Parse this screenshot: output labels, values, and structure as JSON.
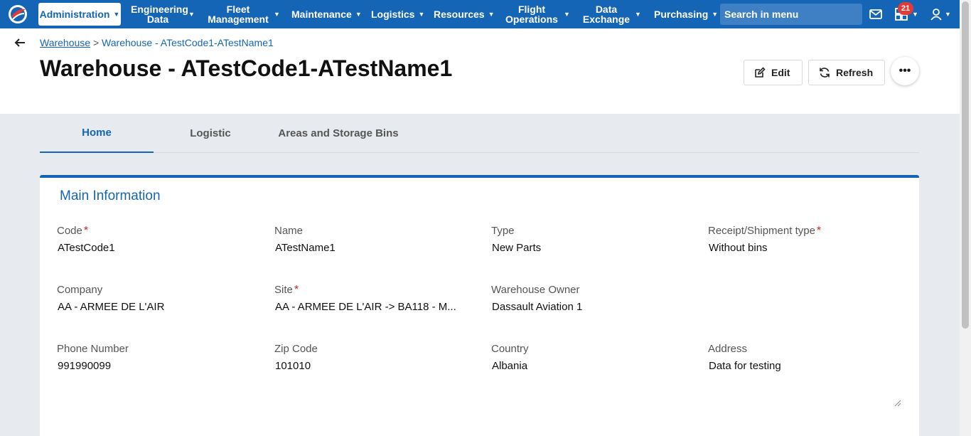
{
  "nav": {
    "items": [
      {
        "label": "Administration"
      },
      {
        "label": "Engineering Data"
      },
      {
        "label": "Fleet Management"
      },
      {
        "label": "Maintenance"
      },
      {
        "label": "Logistics"
      },
      {
        "label": "Resources"
      },
      {
        "label": "Flight Operations"
      },
      {
        "label": "Data Exchange"
      },
      {
        "label": "Purchasing"
      }
    ],
    "search_placeholder": "Search in menu",
    "badge_count": "21",
    "icons": [
      "mail-icon",
      "dashboard-icon",
      "user-icon"
    ],
    "accent_color": "#1565b7"
  },
  "breadcrumb": {
    "link": "Warehouse",
    "separator": ">",
    "current": "Warehouse - ATestCode1-ATestName1"
  },
  "page": {
    "title": "Warehouse - ATestCode1-ATestName1",
    "edit_label": "Edit",
    "refresh_label": "Refresh",
    "more_label": "•••"
  },
  "tabs": [
    {
      "label": "Home",
      "active": true
    },
    {
      "label": "Logistic",
      "active": false
    },
    {
      "label": "Areas and Storage Bins",
      "active": false
    }
  ],
  "section": {
    "title": "Main Information",
    "fields": [
      {
        "label": "Code",
        "required": true,
        "value": "ATestCode1"
      },
      {
        "label": "Name",
        "required": false,
        "value": "ATestName1"
      },
      {
        "label": "Type",
        "required": false,
        "value": "New Parts"
      },
      {
        "label": "Receipt/Shipment type",
        "required": true,
        "value": "Without bins"
      },
      {
        "label": "Company",
        "required": false,
        "value": "AA - ARMEE DE L'AIR"
      },
      {
        "label": "Site",
        "required": true,
        "value": "AA - ARMEE DE L'AIR -> BA118 - M..."
      },
      {
        "label": "Warehouse Owner",
        "required": false,
        "value": "Dassault Aviation 1"
      },
      {
        "label": "Phone Number",
        "required": false,
        "value": "991990099"
      },
      {
        "label": "Zip Code",
        "required": false,
        "value": "101010"
      },
      {
        "label": "Country",
        "required": false,
        "value": "Albania"
      },
      {
        "label": "Address",
        "required": false,
        "value": "Data for testing"
      }
    ]
  }
}
